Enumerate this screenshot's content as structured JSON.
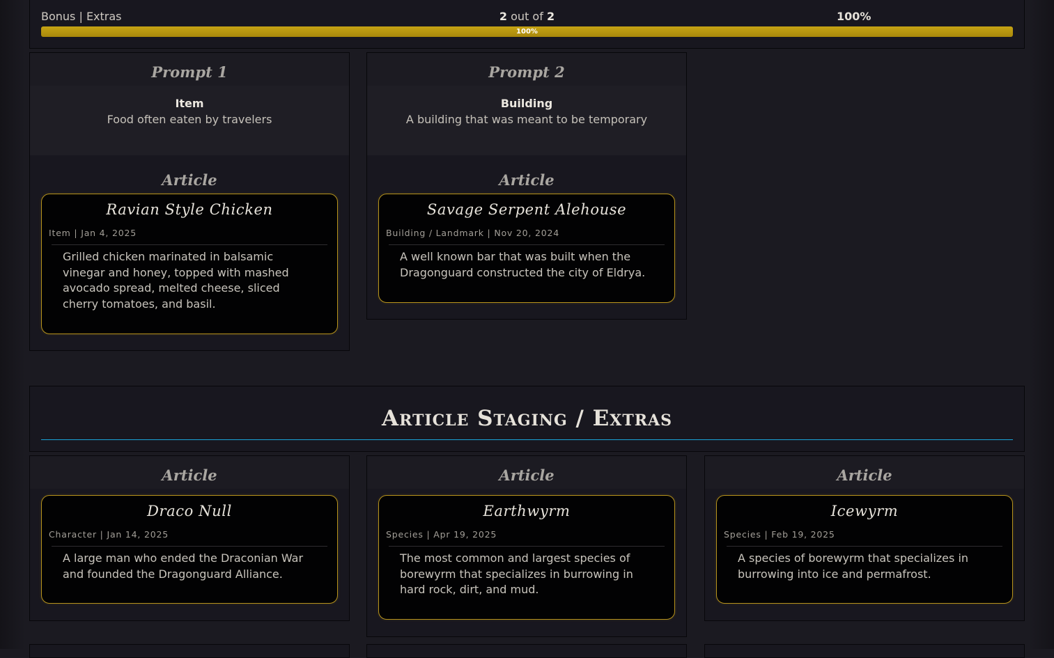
{
  "progress": {
    "label": "Bonus | Extras",
    "done": "2",
    "out_of": "out of",
    "total": "2",
    "percent": "100%",
    "fill_fraction": 1.0,
    "bar_color": "#b8940f"
  },
  "prompts": [
    {
      "heading": "Prompt 1",
      "type": "Item",
      "description": "Food often eaten by travelers",
      "section_label": "Article",
      "article": {
        "title": "Ravian Style Chicken",
        "meta": "Item | Jan 4, 2025",
        "description": "Grilled chicken marinated in balsamic vinegar and honey, topped with mashed avocado spread, melted cheese, sliced cherry tomatoes, and basil."
      }
    },
    {
      "heading": "Prompt 2",
      "type": "Building",
      "description": "A building that was meant to be temporary",
      "section_label": "Article",
      "article": {
        "title": "Savage Serpent Alehouse",
        "meta": "Building / Landmark | Nov 20, 2024",
        "description": "A well known bar that was built when the Dragonguard constructed the city of Eldrya."
      }
    }
  ],
  "staging": {
    "title": "Article Staging / Extras",
    "rule_color": "#1aa4d8"
  },
  "extras": [
    {
      "label": "Article",
      "article": {
        "title": "Draco Null",
        "meta": "Character | Jan 14, 2025",
        "description": "A large man who ended the Draconian War and founded the Dragonguard Alliance."
      }
    },
    {
      "label": "Article",
      "article": {
        "title": "Earthwyrm",
        "meta": "Species | Apr 19, 2025",
        "description": "The most common and largest species of borewyrm that specializes in burrowing in hard rock, dirt, and mud."
      }
    },
    {
      "label": "Article",
      "article": {
        "title": "Icewyrm",
        "meta": "Species | Feb 19, 2025",
        "description": "A species of borewyrm that specializes in burrowing into ice and permafrost."
      }
    }
  ],
  "colors": {
    "background": "#1b1a21",
    "card_border": "#b8941c",
    "card_bg": "#020203"
  }
}
